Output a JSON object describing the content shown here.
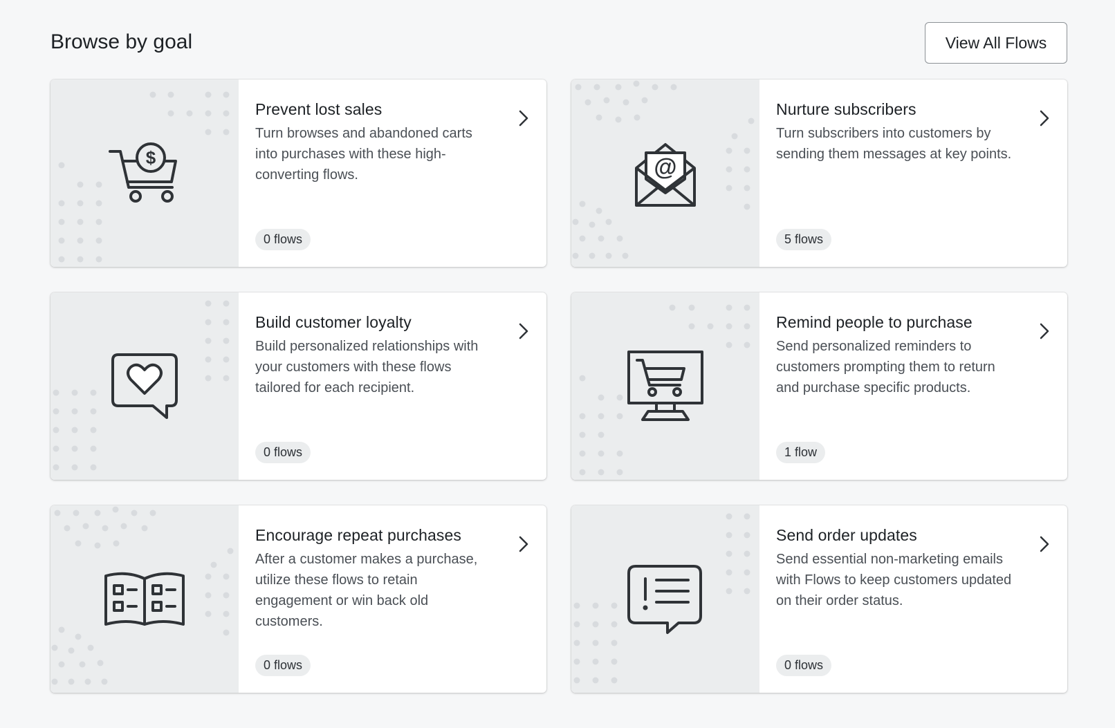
{
  "header": {
    "title": "Browse by goal",
    "view_all_label": "View All Flows"
  },
  "cards": [
    {
      "title": "Prevent lost sales",
      "description": "Turn browses and abandoned carts into purchases with these high-converting flows.",
      "count": "0 flows",
      "icon": "shopping-cart-dollar-icon"
    },
    {
      "title": "Nurture subscribers",
      "description": "Turn subscribers into customers by sending them messages at key points.",
      "count": "5 flows",
      "icon": "envelope-at-icon"
    },
    {
      "title": "Build customer loyalty",
      "description": "Build personalized relationships with your customers with these flows tailored for each recipient.",
      "count": "0 flows",
      "icon": "heart-speech-bubble-icon"
    },
    {
      "title": "Remind people to purchase",
      "description": "Send personalized reminders to customers prompting them to return and purchase specific products.",
      "count": "1 flow",
      "icon": "monitor-cart-icon"
    },
    {
      "title": "Encourage repeat purchases",
      "description": "After a customer makes a purchase, utilize these flows to retain engagement or win back old customers.",
      "count": "0 flows",
      "icon": "open-catalog-icon"
    },
    {
      "title": "Send order updates",
      "description": "Send essential non-marketing emails with Flows to keep customers updated on their order status.",
      "count": "0 flows",
      "icon": "alert-message-icon"
    }
  ],
  "colors": {
    "background": "#f6f7f8",
    "art_panel": "#ebedee",
    "dots": "#d8dbde",
    "icon_stroke": "#2f3337"
  }
}
